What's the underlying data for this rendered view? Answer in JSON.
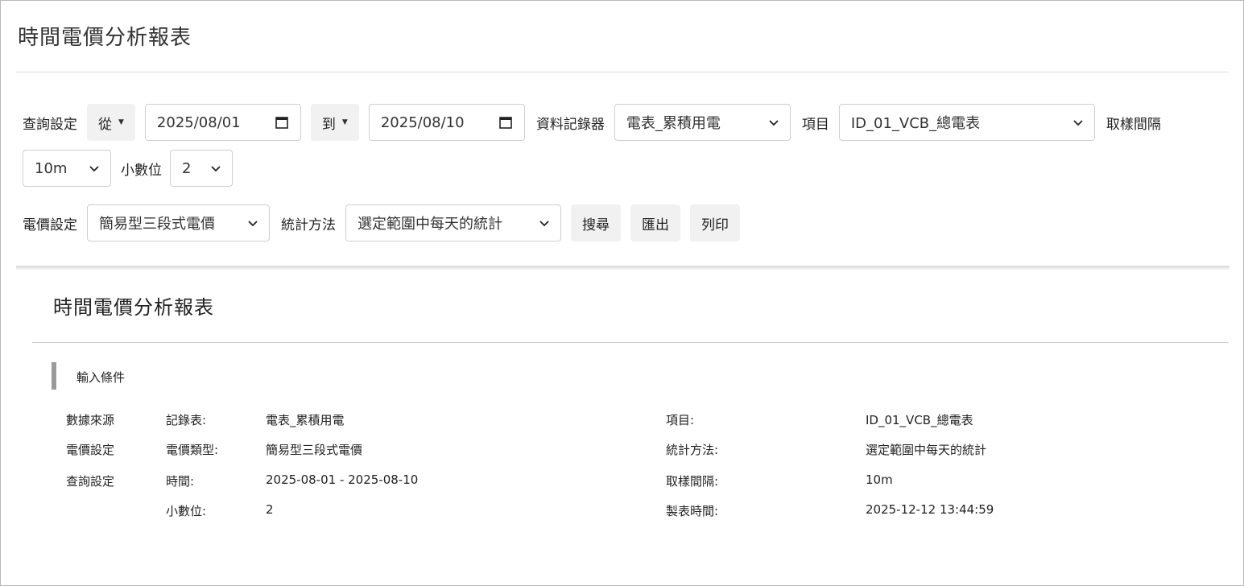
{
  "page": {
    "title": "時間電價分析報表"
  },
  "query": {
    "label": "查詢設定",
    "from_label": "從",
    "from_date": "2025/08/01",
    "to_label": "到",
    "to_date": "2025/08/10",
    "logger_label": "資料記錄器",
    "logger_value": "電表_累積用電",
    "item_label": "項目",
    "item_value": "ID_01_VCB_總電表",
    "interval_label": "取樣間隔",
    "interval_value": "10m",
    "decimal_label": "小數位",
    "decimal_value": "2"
  },
  "price": {
    "label": "電價設定",
    "value": "簡易型三段式電價",
    "stat_label": "統計方法",
    "stat_value": "選定範圍中每天的統計"
  },
  "actions": {
    "search": "搜尋",
    "export": "匯出",
    "print": "列印"
  },
  "report": {
    "title": "時間電價分析報表",
    "section": "輸入條件",
    "rows": {
      "source_head": "數據來源",
      "price_head": "電價設定",
      "query_head": "查詢設定",
      "logger_key": "記錄表:",
      "logger_val": "電表_累積用電",
      "item_key": "項目:",
      "item_val": "ID_01_VCB_總電表",
      "price_type_key": "電價類型:",
      "price_type_val": "簡易型三段式電價",
      "stat_key": "統計方法:",
      "stat_val": "選定範圍中每天的統計",
      "time_key": "時間:",
      "time_val": "2025-08-01 - 2025-08-10",
      "interval_key": "取樣間隔:",
      "interval_val": "10m",
      "decimal_key": "小數位:",
      "decimal_val": "2",
      "created_key": "製表時間:",
      "created_val": "2025-12-12 13:44:59"
    }
  }
}
